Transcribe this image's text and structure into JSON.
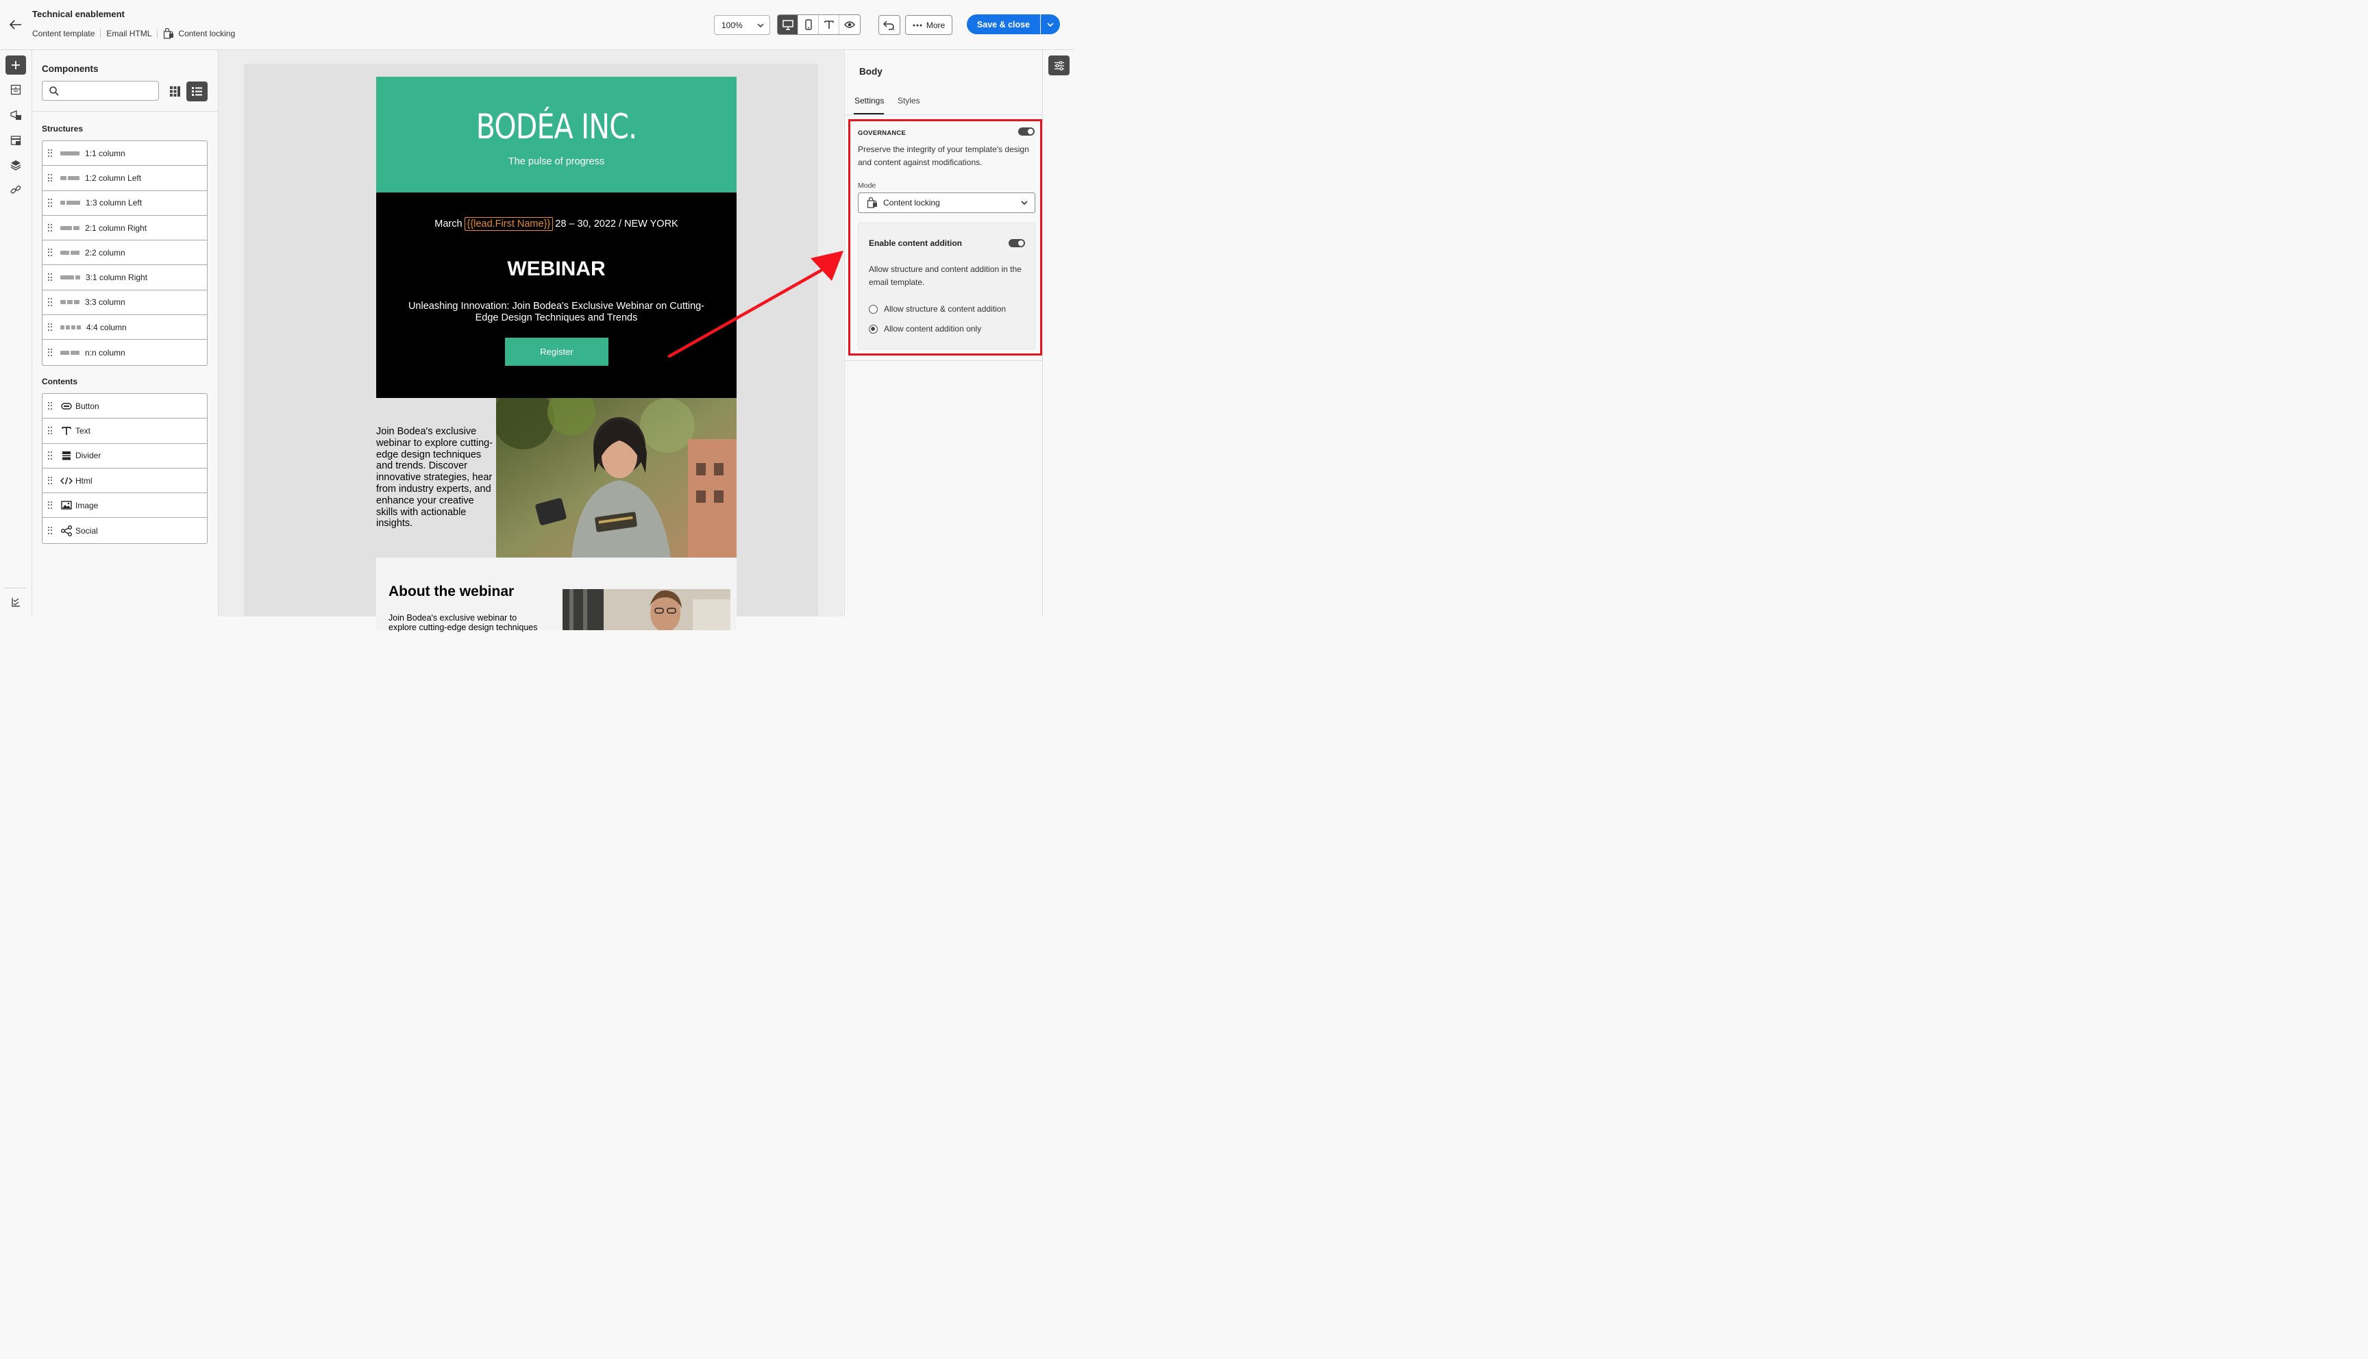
{
  "header": {
    "title": "Technical enablement",
    "crumbs": [
      "Content template",
      "Email HTML",
      "Content locking"
    ],
    "zoom": "100%",
    "more_label": "More",
    "save_label": "Save & close"
  },
  "components": {
    "title": "Components",
    "search_placeholder": "",
    "structures_label": "Structures",
    "structures": [
      {
        "label": "1:1 column",
        "cols": [
          1
        ]
      },
      {
        "label": "1:2 column Left",
        "cols": [
          1,
          2
        ]
      },
      {
        "label": "1:3 column Left",
        "cols": [
          1,
          3
        ]
      },
      {
        "label": "2:1 column Right",
        "cols": [
          2,
          1
        ]
      },
      {
        "label": "2:2 column",
        "cols": [
          1,
          1
        ]
      },
      {
        "label": "3:1 column Right",
        "cols": [
          3,
          1
        ]
      },
      {
        "label": "3:3 column",
        "cols": [
          1,
          1,
          1
        ]
      },
      {
        "label": "4:4 column",
        "cols": [
          1,
          1,
          1,
          1
        ]
      },
      {
        "label": "n:n column",
        "cols": [
          1,
          1
        ]
      }
    ],
    "contents_label": "Contents",
    "contents": [
      {
        "label": "Button",
        "icon": "button-icon"
      },
      {
        "label": "Text",
        "icon": "text-icon"
      },
      {
        "label": "Divider",
        "icon": "divider-icon"
      },
      {
        "label": "Html",
        "icon": "html-icon"
      },
      {
        "label": "Image",
        "icon": "image-icon"
      },
      {
        "label": "Social",
        "icon": "social-icon"
      }
    ]
  },
  "email": {
    "brand": "BODÉA INC.",
    "tagline": "The pulse of progress",
    "date_prefix": "March",
    "token": "{{lead.First Name}}",
    "date_suffix": "28 – 30, 2022 / NEW YORK",
    "headline": "WEBINAR",
    "subtitle": "Unleashing Innovation: Join Bodea's Exclusive Webinar on Cutting-Edge Design Techniques and Trends",
    "register_label": "Register",
    "body_text": "Join Bodea's exclusive webinar to explore cutting-edge design techniques and trends. Discover innovative strategies, hear from industry experts, and enhance your creative skills with actionable insights.",
    "about_title": "About the webinar",
    "about_text": "Join Bodea's exclusive webinar to explore cutting-edge design techniques"
  },
  "properties": {
    "title": "Body",
    "tabs": [
      "Settings",
      "Styles"
    ],
    "governance_label": "GOVERNANCE",
    "governance_enabled": true,
    "governance_desc": "Preserve the integrity of your template's design and content against modifications.",
    "mode_label": "Mode",
    "mode_value": "Content locking",
    "enable_label": "Enable content addition",
    "enable_on": true,
    "enable_desc": "Allow structure and content addition in the email template.",
    "radio_options": [
      "Allow structure & content addition",
      "Allow content addition only"
    ],
    "radio_selected": 1
  },
  "colors": {
    "accent": "#1473e6",
    "brand_green": "#38b48c",
    "highlight_red": "#e5141e",
    "token_orange": "#e8892b"
  }
}
